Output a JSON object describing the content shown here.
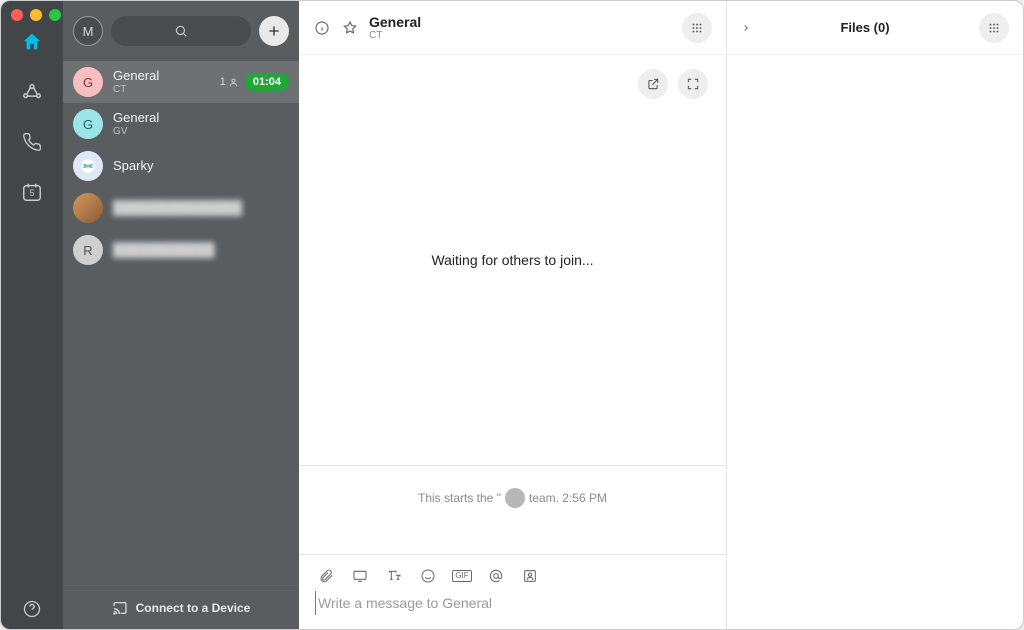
{
  "nav": {
    "calendar_day": "5"
  },
  "sidebar": {
    "me_initial": "M",
    "conversations": [
      {
        "title": "General",
        "sub": "CT",
        "count": "1",
        "timer": "01:04"
      },
      {
        "title": "General",
        "sub": "GV"
      },
      {
        "title": "Sparky",
        "sub": ""
      },
      {
        "title": "██████████████",
        "sub": ""
      },
      {
        "title": "███████████",
        "sub": ""
      }
    ],
    "r_initial": "R",
    "connect_label": "Connect to a Device"
  },
  "main": {
    "title": "General",
    "subtitle": "CT",
    "waiting_text": "Waiting for others to join...",
    "thread_start_prefix": "This starts the \"",
    "thread_start_suffix": "team.  2:56 PM",
    "compose_placeholder": "Write a message to General"
  },
  "files": {
    "title": "Files (0)"
  }
}
